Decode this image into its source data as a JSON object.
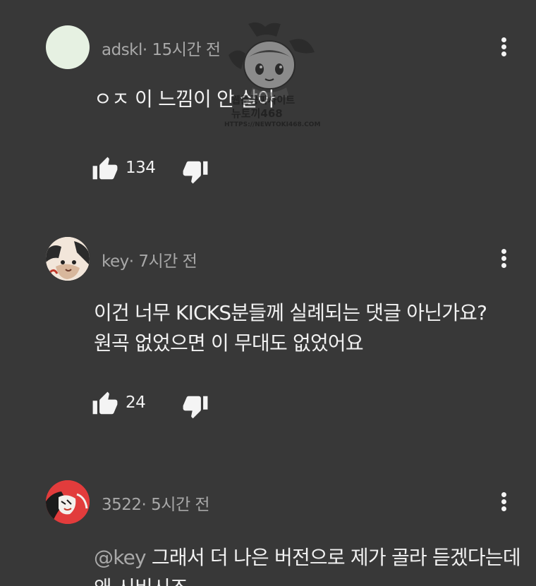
{
  "comments": [
    {
      "author": "adskl",
      "time": "15시간 전",
      "avatar_color": "#e6f1e2",
      "lines": [
        "ㅇㅈ 이 느낌이 안 살아"
      ],
      "likes": "134"
    },
    {
      "author": "key",
      "time": "7시간 전",
      "lines": [
        "이건 너무 KICKS분들께 실례되는 댓글 아닌가요?",
        "원곡 없었으면 이 무대도 없었어요"
      ],
      "likes": "24"
    },
    {
      "author": "3522",
      "time": "5시간 전",
      "mention": "@key",
      "lines": [
        " 그래서 더 나은 버전으로 제가 골라 듣겠다는데",
        "왜 시비시죠"
      ]
    }
  ],
  "watermark": {
    "line1": "웹툰공짜사이트",
    "line2": "뉴토끼468",
    "url": "HTTPS://NEWTOKI468.COM"
  },
  "icons": {
    "like": "thumbs-up-icon",
    "dislike": "thumbs-down-icon",
    "more": "more-vertical-icon"
  },
  "colors": {
    "background": "#383838",
    "text": "#f1f1f1",
    "meta": "#a8a8a8"
  }
}
